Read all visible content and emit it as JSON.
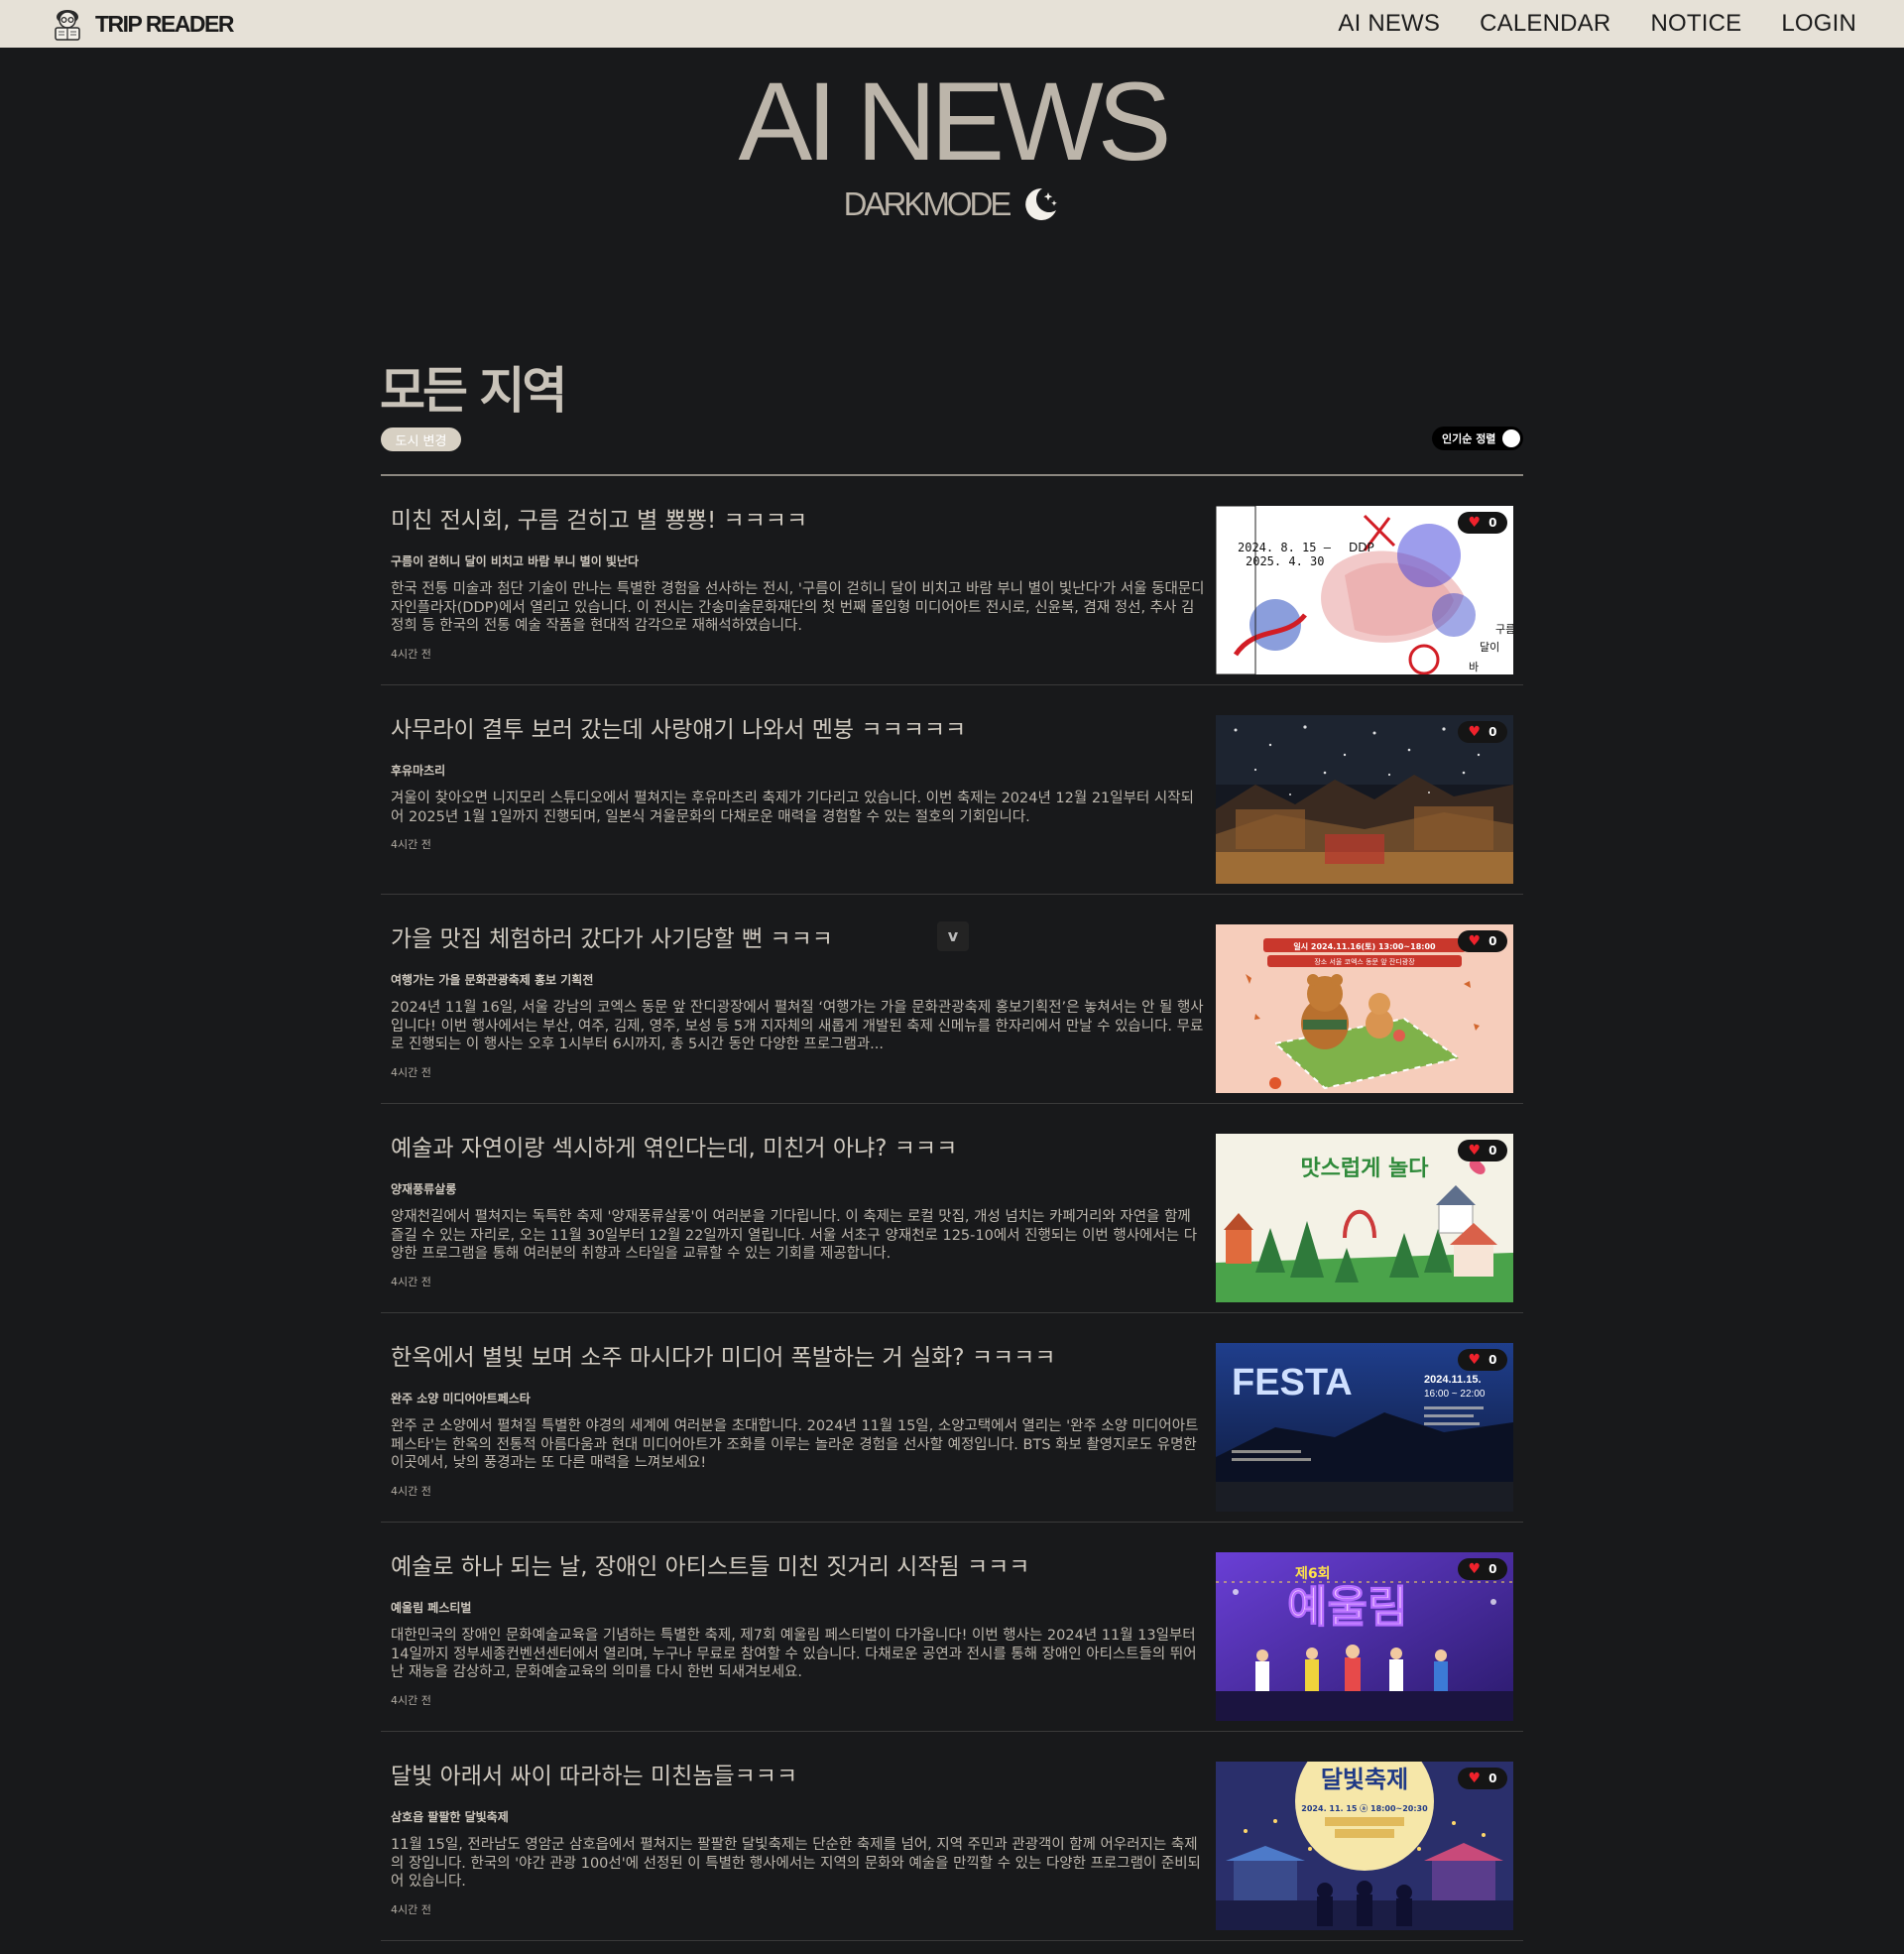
{
  "brand": {
    "name": "TRIP READER",
    "logo_icon": "reader-mascot-icon"
  },
  "nav": {
    "links": [
      {
        "label": "AI NEWS"
      },
      {
        "label": "CALENDAR"
      },
      {
        "label": "NOTICE"
      },
      {
        "label": "LOGIN"
      }
    ]
  },
  "hero": {
    "title": "AI NEWS",
    "mode_label": "DARKMODE",
    "mode_icon": "moon-stars-icon"
  },
  "region": {
    "title": "모든 지역",
    "change_city_label": "도시 변경",
    "sort_label": "인기순 정렬"
  },
  "scroll_hint": {
    "icon": "chevron-down-icon",
    "glyph": "v"
  },
  "colors": {
    "background": "#18191b",
    "topbar": "#e6e1d7",
    "heart": "#f0222c",
    "accent_pill": "#d7d0c3"
  },
  "articles": [
    {
      "title": "미친 전시회, 구름 걷히고 별 뿅뿅! ㅋㅋㅋㅋ",
      "subtitle": "구름이 걷히니 달이 비치고 바람 부니 별이 빛난다",
      "description": "한국 전통 미술과 첨단 기술이 만나는 특별한 경험을 선사하는 전시, '구름이 걷히니 달이 비치고 바람 부니 별이 빛난다'가 서울 동대문디자인플라자(DDP)에서 열리고 있습니다. 이 전시는 간송미술문화재단의 첫 번째 몰입형 미디어아트 전시로, 신윤복, 겸재 정선, 추사 김정희 등 한국의 전통 예술 작품을 현대적 감각으로 재해석하였습니다.",
      "time": "4시간 전",
      "likes": "0",
      "image_texts": [
        "2024. 8. 15 —",
        "2025. 4. 30",
        "DDP",
        "구름이",
        "달이",
        "바"
      ]
    },
    {
      "title": "사무라이 결투 보러 갔는데 사랑얘기 나와서 멘붕 ㅋㅋㅋㅋㅋ",
      "subtitle": "후유마츠리",
      "description": "겨울이 찾아오면 니지모리 스튜디오에서 펼쳐지는 후유마츠리 축제가 기다리고 있습니다. 이번 축제는 2024년 12월 21일부터 시작되어 2025년 1월 1일까지 진행되며, 일본식 겨울문화의 다채로운 매력을 경험할 수 있는 절호의 기회입니다.",
      "time": "4시간 전",
      "likes": "0"
    },
    {
      "title": "가을 맛집 체험하러 갔다가 사기당할 뻔 ㅋㅋㅋ",
      "subtitle": "여행가는 가을 문화관광축제 홍보 기획전",
      "description": "2024년 11월 16일, 서울 강남의 코엑스 동문 앞 잔디광장에서 펼쳐질 ‘여행가는 가을 문화관광축제 홍보기획전’은 놓쳐서는 안 될 행사입니다! 이번 행사에서는 부산, 여주, 김제, 영주, 보성 등 5개 지자체의 새롭게 개발된 축제 신메뉴를 한자리에서 만날 수 있습니다. 무료로 진행되는 이 행사는 오후 1시부터 6시까지, 총 5시간 동안 다양한 프로그램과...",
      "time": "4시간 전",
      "likes": "0",
      "image_texts": [
        "일시 2024.11.16(토) 13:00~18:00",
        "장소 서울 코엑스 동문 앞 잔디광장"
      ]
    },
    {
      "title": "예술과 자연이랑 섹시하게 엮인다는데, 미친거 아냐? ㅋㅋㅋ",
      "subtitle": "양재풍류살롱",
      "description": "양재천길에서 펼쳐지는 독특한 축제 '양재풍류살롱'이 여러분을 기다립니다. 이 축제는 로컬 맛집, 개성 넘치는 카페거리와 자연을 함께 즐길 수 있는 자리로, 오는 11월 30일부터 12월 22일까지 열립니다. 서울 서초구 양재천로 125-10에서 진행되는 이번 행사에서는 다양한 프로그램을 통해 여러분의 취향과 스타일을 교류할 수 있는 기회를 제공합니다.",
      "time": "4시간 전",
      "likes": "0",
      "image_texts": [
        "맛스럽게 놀다"
      ]
    },
    {
      "title": "한옥에서 별빛 보며 소주 마시다가 미디어 폭발하는 거 실화? ㅋㅋㅋㅋ",
      "subtitle": "완주 소양 미디어아트페스타",
      "description": "완주 군 소양에서 펼쳐질 특별한 야경의 세계에 여러분을 초대합니다. 2024년 11월 15일, 소양고택에서 열리는 '완주 소양 미디어아트페스타'는 한옥의 전통적 아름다움과 현대 미디어아트가 조화를 이루는 놀라운 경험을 선사할 예정입니다. BTS 화보 촬영지로도 유명한 이곳에서, 낮의 풍경과는 또 다른 매력을 느껴보세요!",
      "time": "4시간 전",
      "likes": "0",
      "image_texts": [
        "FESTA",
        "2024.11.15.",
        "16:00 ~ 22:00"
      ]
    },
    {
      "title": "예술로 하나 되는 날, 장애인 아티스트들 미친 짓거리 시작됨 ㅋㅋㅋ",
      "subtitle": "예울림 페스티벌",
      "description": "대한민국의 장애인 문화예술교육을 기념하는 특별한 축제, 제7회 예울림 페스티벌이 다가옵니다! 이번 행사는 2024년 11월 13일부터 14일까지 정부세종컨벤션센터에서 열리며, 누구나 무료로 참여할 수 있습니다. 다채로운 공연과 전시를 통해 장애인 아티스트들의 뛰어난 재능을 감상하고, 문화예술교육의 의미를 다시 한번 되새겨보세요.",
      "time": "4시간 전",
      "likes": "0",
      "image_texts": [
        "제6회",
        "예울림"
      ]
    },
    {
      "title": "달빛 아래서 싸이 따라하는 미친놈들ㅋㅋㅋ",
      "subtitle": "삼호읍 팔팔한 달빛축제",
      "description": "11월 15일, 전라남도 영암군 삼호읍에서 펼쳐지는 팔팔한 달빛축제는 단순한 축제를 넘어, 지역 주민과 관광객이 함께 어우러지는 축제의 장입니다. 한국의 '야간 관광 100선'에 선정된 이 특별한 행사에서는 지역의 문화와 예술을 만끽할 수 있는 다양한 프로그램이 준비되어 있습니다.",
      "time": "4시간 전",
      "likes": "0",
      "image_texts": [
        "달빛축제",
        "2024. 11. 15 ⓐ 18:00~20:30"
      ]
    }
  ]
}
